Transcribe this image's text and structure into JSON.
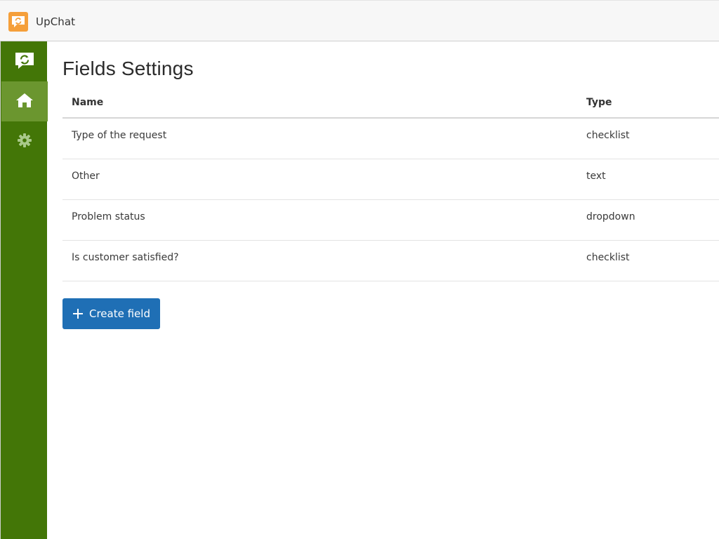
{
  "app": {
    "name": "UpChat",
    "logo_icon": "chat-bubble-refresh-icon",
    "accent": "#f59f3a"
  },
  "sidebar": {
    "background": "#437607",
    "active_background": "#6b962f",
    "items": [
      {
        "id": "brand",
        "icon": "chat-bubble-refresh-icon"
      },
      {
        "id": "home",
        "icon": "home-icon",
        "active": true
      },
      {
        "id": "settings",
        "icon": "gear-icon"
      }
    ]
  },
  "page": {
    "title": "Fields Settings"
  },
  "table": {
    "columns": [
      "Name",
      "Type"
    ],
    "rows": [
      {
        "name": "Type of the request",
        "type": "checklist"
      },
      {
        "name": "Other",
        "type": "text"
      },
      {
        "name": "Problem status",
        "type": "dropdown"
      },
      {
        "name": "Is customer satisfied?",
        "type": "checklist"
      }
    ]
  },
  "actions": {
    "create_label": "Create field",
    "create_icon": "plus-icon",
    "create_color": "#1f6fb5"
  }
}
